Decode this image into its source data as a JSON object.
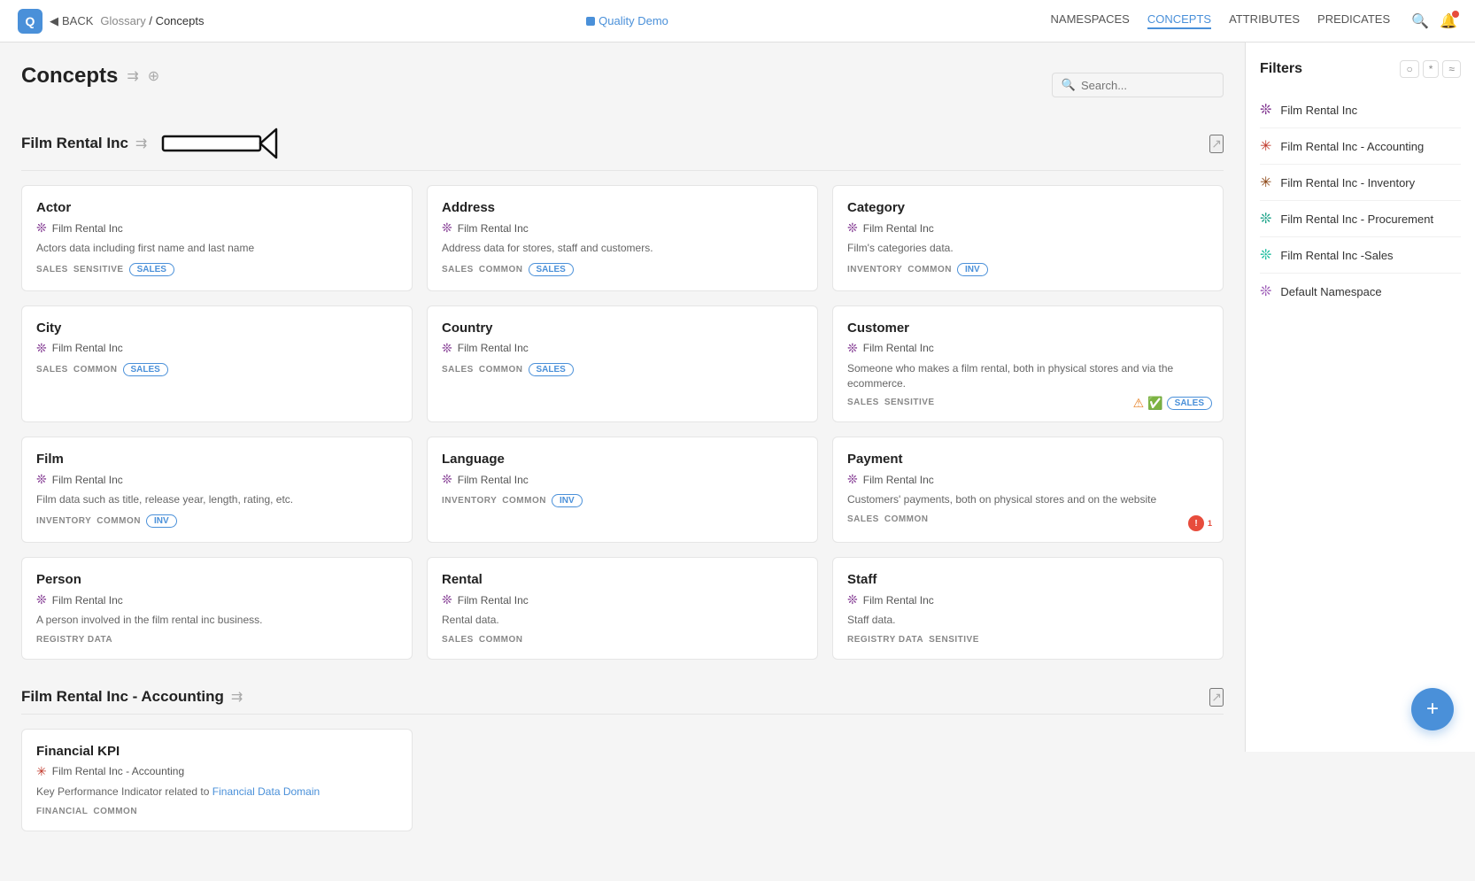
{
  "topNav": {
    "logoText": "Q",
    "backLabel": "BACK",
    "breadcrumb": [
      "Glossary",
      "Concepts"
    ],
    "qualityDemo": "Quality Demo",
    "links": [
      {
        "label": "NAMESPACES",
        "active": false
      },
      {
        "label": "CONCEPTS",
        "active": true
      },
      {
        "label": "ATTRIBUTES",
        "active": false
      },
      {
        "label": "PREDICATES",
        "active": false
      }
    ]
  },
  "pageTitle": "Concepts",
  "search": {
    "placeholder": "Search...",
    "value": ""
  },
  "filters": {
    "title": "Filters",
    "buttons": [
      "○",
      "*",
      "≈"
    ],
    "items": [
      {
        "icon": "❊",
        "label": "Film Rental Inc",
        "iconClass": "fi-purple"
      },
      {
        "icon": "✳",
        "label": "Film Rental Inc - Accounting",
        "iconClass": "fi-red"
      },
      {
        "icon": "✳",
        "label": "Film Rental Inc - Inventory",
        "iconClass": "fi-brown"
      },
      {
        "icon": "❊",
        "label": "Film Rental Inc - Procurement",
        "iconClass": "fi-teal"
      },
      {
        "icon": "❊",
        "label": "Film Rental Inc -Sales",
        "iconClass": "fi-light-teal"
      },
      {
        "icon": "❊",
        "label": "Default Namespace",
        "iconClass": "fi-light-purple"
      }
    ]
  },
  "sections": [
    {
      "id": "film-rental-inc",
      "title": "Film Rental Inc",
      "cards": [
        {
          "id": "actor",
          "title": "Actor",
          "namespace": "Film Rental Inc",
          "namespaceIconClass": "ns-icon-purple",
          "desc": "Actors data including first name and last name",
          "tags": [
            "SALES",
            "SENSITIVE"
          ],
          "badge": "SALES",
          "badgeClass": "badge-sales",
          "warnIcon": false,
          "checkIcon": false,
          "errorBadge": null
        },
        {
          "id": "address",
          "title": "Address",
          "namespace": "Film Rental Inc",
          "namespaceIconClass": "ns-icon-purple",
          "desc": "Address data for stores, staff and customers.",
          "tags": [
            "SALES",
            "COMMON"
          ],
          "badge": "SALES",
          "badgeClass": "badge-sales",
          "warnIcon": false,
          "checkIcon": false,
          "errorBadge": null
        },
        {
          "id": "category",
          "title": "Category",
          "namespace": "Film Rental Inc",
          "namespaceIconClass": "ns-icon-purple",
          "desc": "Film's categories data.",
          "tags": [
            "INVENTORY",
            "COMMON"
          ],
          "badge": "INV",
          "badgeClass": "badge-inv",
          "warnIcon": false,
          "checkIcon": false,
          "errorBadge": null
        },
        {
          "id": "city",
          "title": "City",
          "namespace": "Film Rental Inc",
          "namespaceIconClass": "ns-icon-purple",
          "desc": "",
          "tags": [
            "SALES",
            "COMMON"
          ],
          "badge": "SALES",
          "badgeClass": "badge-sales",
          "warnIcon": false,
          "checkIcon": false,
          "errorBadge": null
        },
        {
          "id": "country",
          "title": "Country",
          "namespace": "Film Rental Inc",
          "namespaceIconClass": "ns-icon-purple",
          "desc": "",
          "tags": [
            "SALES",
            "COMMON"
          ],
          "badge": "SALES",
          "badgeClass": "badge-sales",
          "warnIcon": false,
          "checkIcon": false,
          "errorBadge": null
        },
        {
          "id": "customer",
          "title": "Customer",
          "namespace": "Film Rental Inc",
          "namespaceIconClass": "ns-icon-purple",
          "desc": "Someone who makes a film rental, both in physical stores and via the ecommerce.",
          "tags": [
            "SALES",
            "SENSITIVE"
          ],
          "badge": "SALES",
          "badgeClass": "badge-sales",
          "warnIcon": true,
          "checkIcon": true,
          "errorBadge": null
        },
        {
          "id": "film",
          "title": "Film",
          "namespace": "Film Rental Inc",
          "namespaceIconClass": "ns-icon-purple",
          "desc": "Film data such as title, release year, length, rating, etc.",
          "tags": [
            "INVENTORY",
            "COMMON"
          ],
          "badge": "INV",
          "badgeClass": "badge-inv",
          "warnIcon": false,
          "checkIcon": false,
          "errorBadge": null
        },
        {
          "id": "language",
          "title": "Language",
          "namespace": "Film Rental Inc",
          "namespaceIconClass": "ns-icon-purple",
          "desc": "",
          "tags": [
            "INVENTORY",
            "COMMON"
          ],
          "badge": "INV",
          "badgeClass": "badge-inv",
          "warnIcon": false,
          "checkIcon": false,
          "errorBadge": null
        },
        {
          "id": "payment",
          "title": "Payment",
          "namespace": "Film Rental Inc",
          "namespaceIconClass": "ns-icon-purple",
          "desc": "Customers' payments, both on physical stores and on the website",
          "tags": [
            "SALES",
            "COMMON"
          ],
          "badge": null,
          "badgeClass": "",
          "warnIcon": false,
          "checkIcon": false,
          "errorBadge": "1"
        },
        {
          "id": "person",
          "title": "Person",
          "namespace": "Film Rental Inc",
          "namespaceIconClass": "ns-icon-purple",
          "desc": "A person involved in the film rental inc business.",
          "tags": [
            "REGISTRY DATA"
          ],
          "badge": null,
          "badgeClass": "",
          "warnIcon": false,
          "checkIcon": false,
          "errorBadge": null
        },
        {
          "id": "rental",
          "title": "Rental",
          "namespace": "Film Rental Inc",
          "namespaceIconClass": "ns-icon-purple",
          "desc": "Rental data.",
          "tags": [
            "SALES",
            "COMMON"
          ],
          "badge": null,
          "badgeClass": "",
          "warnIcon": false,
          "checkIcon": false,
          "errorBadge": null
        },
        {
          "id": "staff",
          "title": "Staff",
          "namespace": "Film Rental Inc",
          "namespaceIconClass": "ns-icon-purple",
          "desc": "Staff data.",
          "tags": [
            "REGISTRY DATA",
            "SENSITIVE"
          ],
          "badge": null,
          "badgeClass": "",
          "warnIcon": false,
          "checkIcon": false,
          "errorBadge": null
        }
      ]
    },
    {
      "id": "film-rental-inc-accounting",
      "title": "Film Rental Inc - Accounting",
      "cards": [
        {
          "id": "financial-kpi",
          "title": "Financial KPI",
          "namespace": "Film Rental Inc - Accounting",
          "namespaceIconClass": "ns-icon-red",
          "desc": "Key Performance Indicator related to Financial Data Domain",
          "descLink": "Financial Data Domain",
          "tags": [
            "FINANCIAL",
            "COMMON"
          ],
          "badge": null,
          "badgeClass": "",
          "warnIcon": false,
          "checkIcon": false,
          "errorBadge": null
        }
      ]
    }
  ],
  "fab": {
    "label": "+"
  }
}
